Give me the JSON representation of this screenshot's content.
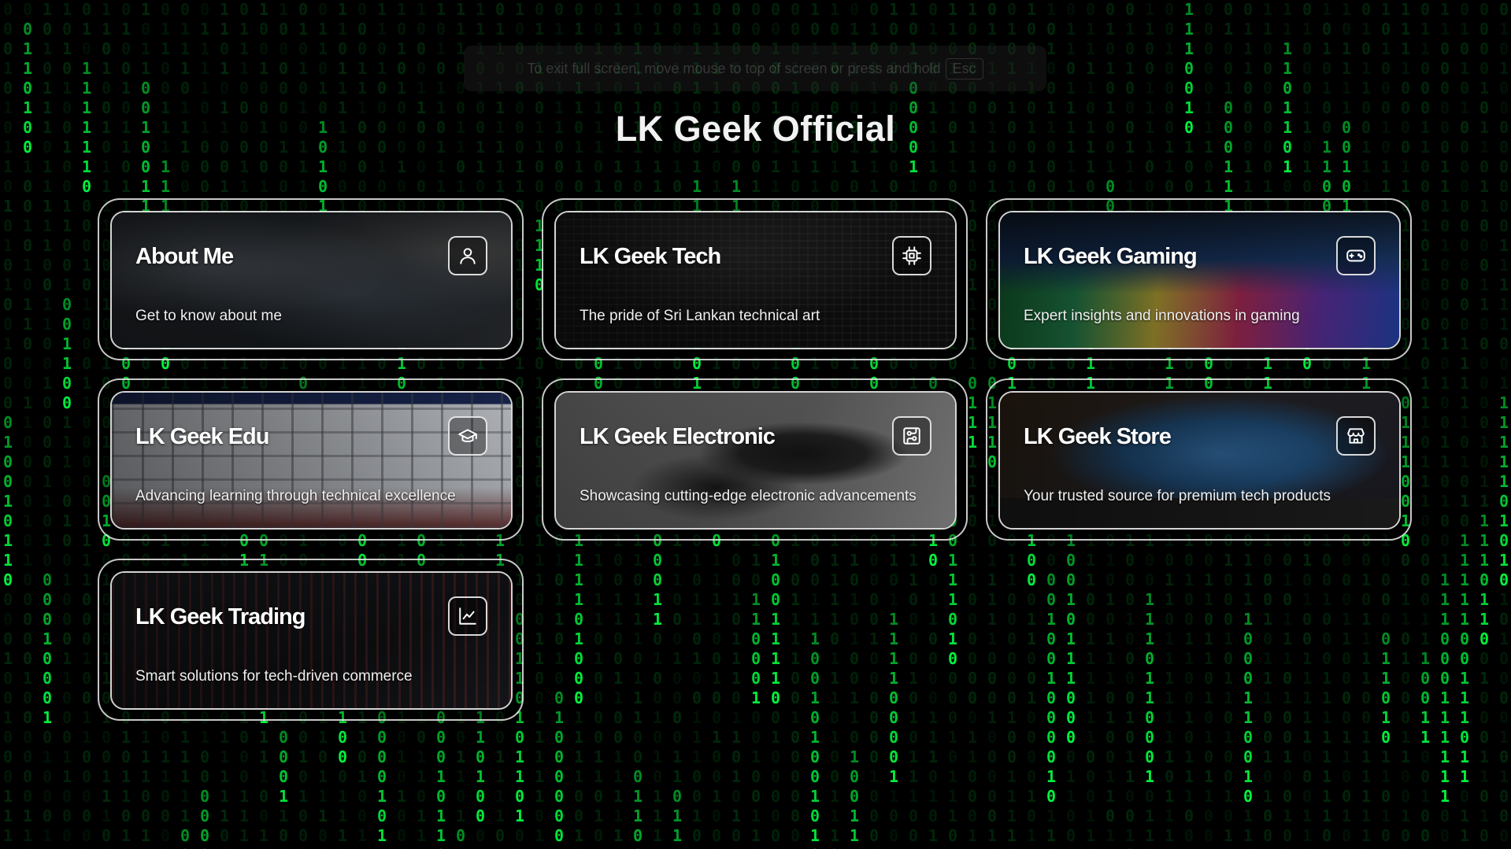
{
  "page": {
    "title": "LK Geek Official",
    "fullscreen_notice": "To exit full screen, move mouse to top of screen or press and hold",
    "fullscreen_key": "Esc"
  },
  "colors": {
    "matrix_green": "#00ff41",
    "background": "#000000"
  },
  "cards": [
    {
      "title": "About Me",
      "description": "Get to know about me",
      "icon": "user-icon"
    },
    {
      "title": "LK Geek Tech",
      "description": "The pride of Sri Lankan technical art",
      "icon": "chip-icon"
    },
    {
      "title": "LK Geek Gaming",
      "description": "Expert insights and innovations in gaming",
      "icon": "gamepad-icon"
    },
    {
      "title": "LK Geek Edu",
      "description": "Advancing learning through technical excellence",
      "icon": "graduation-cap-icon"
    },
    {
      "title": "LK Geek Electronic",
      "description": "Showcasing cutting-edge electronic advancements",
      "icon": "circuit-board-icon"
    },
    {
      "title": "LK Geek Store",
      "description": "Your trusted source for premium tech products",
      "icon": "store-icon"
    },
    {
      "title": "LK Geek Trading",
      "description": "Smart solutions for tech-driven commerce",
      "icon": "chart-line-icon"
    }
  ]
}
